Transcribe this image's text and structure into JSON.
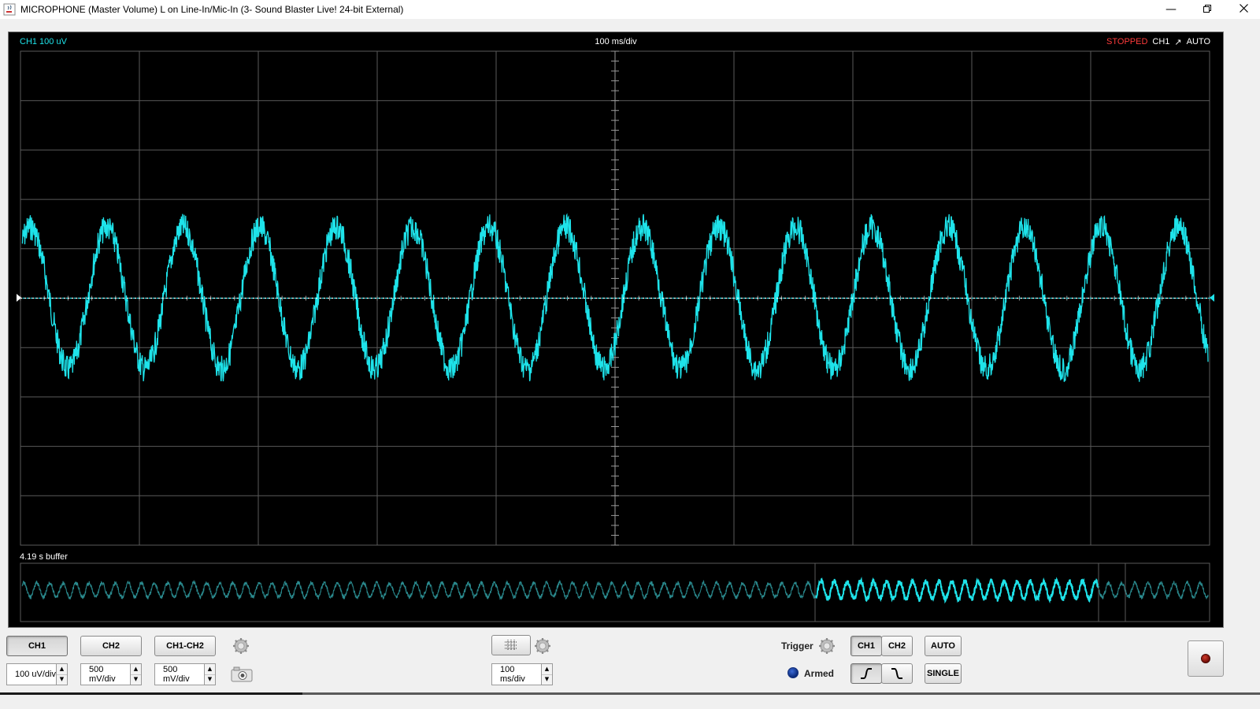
{
  "window": {
    "title": "MICROPHONE (Master Volume) L on Line-In/Mic-In (3- Sound Blaster Live! 24-bit External)",
    "icons": {
      "app": "java-cup-icon",
      "min": "minimize-icon",
      "max": "restore-icon",
      "close": "close-icon"
    }
  },
  "scope": {
    "channel_scale": "CH1 100 uV",
    "timebase": "100 ms/div",
    "status": "STOPPED",
    "trigger_channel": "CH1",
    "trigger_mode": "AUTO",
    "buffer_label": "4.19 s buffer",
    "trace_color": "#1ee3ea",
    "grid_color": "#5a5a5a"
  },
  "controls": {
    "ch1": "CH1",
    "ch2": "CH2",
    "ch1_ch2": "CH1-CH2",
    "ch1_scale": "100 uV/div",
    "ch2_scale": "500 mV/div",
    "diff_scale": "500 mV/div",
    "timebase_scale": "100 ms/div",
    "trigger_label": "Trigger",
    "trigger_ch1": "CH1",
    "trigger_ch2": "CH2",
    "auto": "AUTO",
    "single": "SINGLE",
    "armed": "Armed"
  }
}
